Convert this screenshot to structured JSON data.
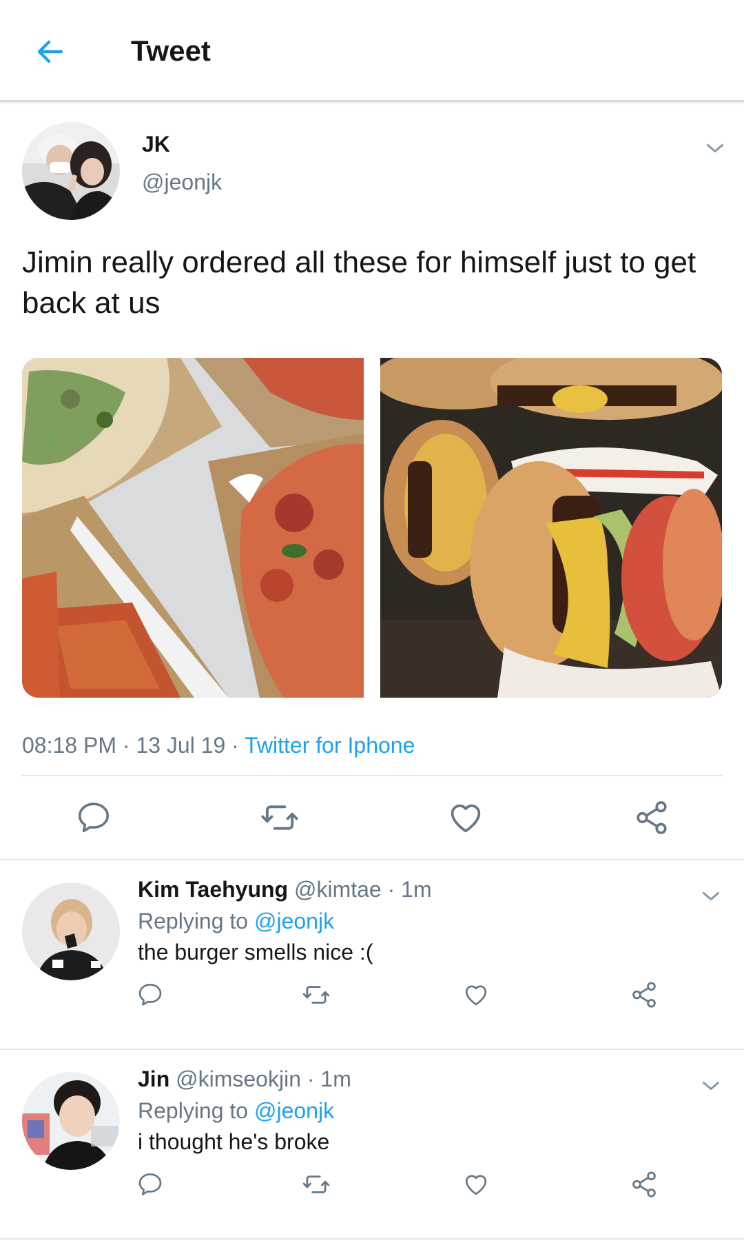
{
  "header": {
    "title": "Tweet",
    "back_icon": "arrow-left-icon",
    "accent_color": "#1da1f2"
  },
  "tweet": {
    "author_name": "JK",
    "author_handle": "@jeonjk",
    "text": "Jimin really ordered all these for himself just to get back at us",
    "images": [
      {
        "subject": "pizzas-in-boxes"
      },
      {
        "subject": "burgers-in-wrappers"
      }
    ],
    "time": "08:18 PM",
    "date": "13 Jul 19",
    "source": "Twitter for Iphone",
    "separator": "·",
    "action_icons": [
      "reply-icon",
      "retweet-icon",
      "like-icon",
      "share-icon"
    ]
  },
  "replies": [
    {
      "name": "Kim Taehyung",
      "handle": "@kimtae",
      "time": "· 1m",
      "replying_prefix": "Replying to",
      "replying_to": "@jeonjk",
      "text": "the burger smells nice :("
    },
    {
      "name": "Jin",
      "handle": "@kimseokjin",
      "time": "· 1m",
      "replying_prefix": "Replying to",
      "replying_to": "@jeonjk",
      "text": "i thought he's broke"
    }
  ],
  "colors": {
    "text_primary": "#14171a",
    "text_secondary": "#657786",
    "link": "#1da1f2",
    "divider": "#e1e8ed"
  }
}
